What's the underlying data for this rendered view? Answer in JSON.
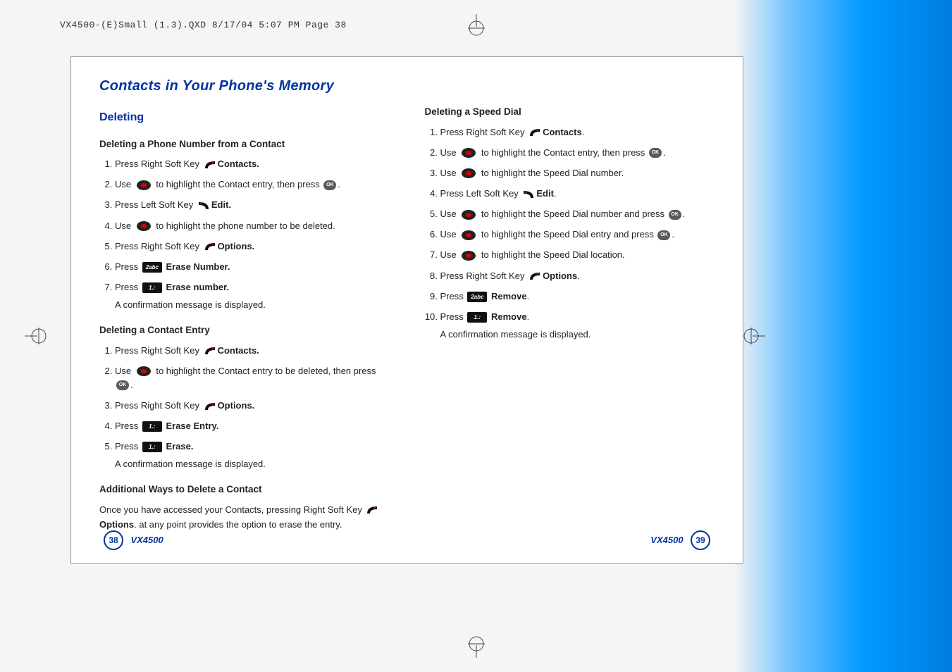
{
  "header": "VX4500-(E)Small (1.3).QXD  8/17/04  5:07 PM  Page 38",
  "section_title": "Contacts in Your Phone's Memory",
  "left": {
    "h_major": "Deleting",
    "sub1": {
      "title": "Deleting a Phone Number from a Contact",
      "steps": [
        {
          "pre": "Press Right Soft Key ",
          "icon": "softkey-right",
          "bold": "Contacts."
        },
        {
          "pre": "Use ",
          "icon": "nav",
          "mid": " to highlight the Contact entry, then press ",
          "icon2": "ok",
          "post": "."
        },
        {
          "pre": "Press Left Soft Key ",
          "icon": "softkey-left",
          "bold": "Edit."
        },
        {
          "pre": "Use ",
          "icon": "nav",
          "mid": " to highlight the phone number to be deleted."
        },
        {
          "pre": "Press Right Soft Key ",
          "icon": "softkey-right",
          "bold": "Options."
        },
        {
          "pre": "Press ",
          "key": "2abc",
          "bold": "Erase Number."
        },
        {
          "pre": "Press ",
          "key": "1.:",
          "bold": "Erase number."
        }
      ],
      "confirm": "A confirmation message is displayed."
    },
    "sub2": {
      "title": "Deleting a Contact Entry",
      "steps": [
        {
          "pre": "Press Right Soft Key ",
          "icon": "softkey-right",
          "bold": "Contacts."
        },
        {
          "pre": "Use ",
          "icon": "nav",
          "mid": " to highlight the Contact entry to be deleted, then press ",
          "icon2": "ok",
          "post": "."
        },
        {
          "pre": "Press Right Soft Key ",
          "icon": "softkey-right",
          "bold": "Options."
        },
        {
          "pre": "Press ",
          "key": "1.:",
          "bold": "Erase Entry."
        },
        {
          "pre": "Press ",
          "key": "1.:",
          "bold": "Erase."
        }
      ],
      "confirm": "A confirmation message is displayed."
    },
    "sub3": {
      "title": "Additional Ways to Delete a Contact",
      "para_pre": "Once you have accessed your Contacts, pressing Right Soft Key ",
      "para_bold": "Options",
      "para_post": ". at any point provides the option to erase the entry."
    }
  },
  "right": {
    "sub1": {
      "title": "Deleting a Speed Dial",
      "steps": [
        {
          "pre": "Press Right Soft Key ",
          "icon": "softkey-right",
          "bold": "Contacts",
          "post": "."
        },
        {
          "pre": "Use ",
          "icon": "nav",
          "mid": " to highlight the Contact entry, then press ",
          "icon2": "ok",
          "post": "."
        },
        {
          "pre": "Use ",
          "icon": "nav",
          "mid": " to highlight the Speed Dial number."
        },
        {
          "pre": "Press Left Soft Key ",
          "icon": "softkey-left",
          "bold": "Edit",
          "post": "."
        },
        {
          "pre": "Use ",
          "icon": "nav",
          "mid": " to highlight the Speed Dial number and press ",
          "icon2": "ok",
          "post": "."
        },
        {
          "pre": "Use ",
          "icon": "nav",
          "mid": " to highlight the Speed Dial entry and press ",
          "icon2": "ok",
          "post": "."
        },
        {
          "pre": "Use ",
          "icon": "nav",
          "mid": " to highlight the Speed Dial location."
        },
        {
          "pre": "Press Right Soft Key ",
          "icon": "softkey-right",
          "bold": "Options",
          "post": "."
        },
        {
          "pre": "Press ",
          "key": "2abc",
          "bold": "Remove",
          "post": "."
        },
        {
          "pre": "Press ",
          "key": "1.:",
          "bold": "Remove",
          "post": "."
        }
      ],
      "confirm": "A confirmation message is displayed."
    }
  },
  "footer": {
    "model": "VX4500",
    "page_left": "38",
    "page_right": "39"
  },
  "ok_label": "OK"
}
